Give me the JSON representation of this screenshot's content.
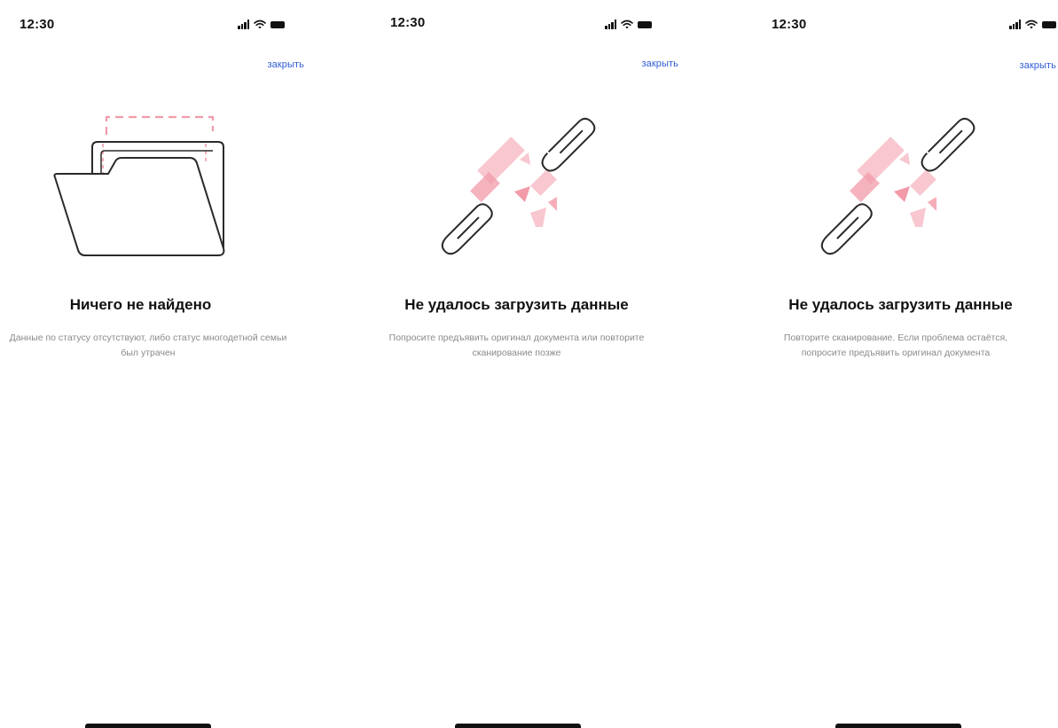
{
  "colors": {
    "accent": "#2f5bd6",
    "pink": "#f29aa8",
    "pink_light": "#f8c7cf",
    "text_primary": "#111111",
    "text_secondary": "#8a8a8a"
  },
  "screens": [
    {
      "status_time": "12:30",
      "close_label": "закрыть",
      "illustration_icon": "folder-icon",
      "title": "Ничего не найдено",
      "description": "Данные по статусу отсутствуют, либо статус многодетной семьи был утрачен"
    },
    {
      "status_time": "12:30",
      "close_label": "закрыть",
      "illustration_icon": "broken-link-icon",
      "title": "Не удалось загрузить данные",
      "description": "Попросите предъявить оригинал документа или повторите сканирование позже"
    },
    {
      "status_time": "12:30",
      "close_label": "закрыть",
      "illustration_icon": "broken-link-icon",
      "title": "Не удалось загрузить данные",
      "description": "Повторите сканирование. Если проблема остаётся, попросите предъявить оригинал документа"
    }
  ]
}
